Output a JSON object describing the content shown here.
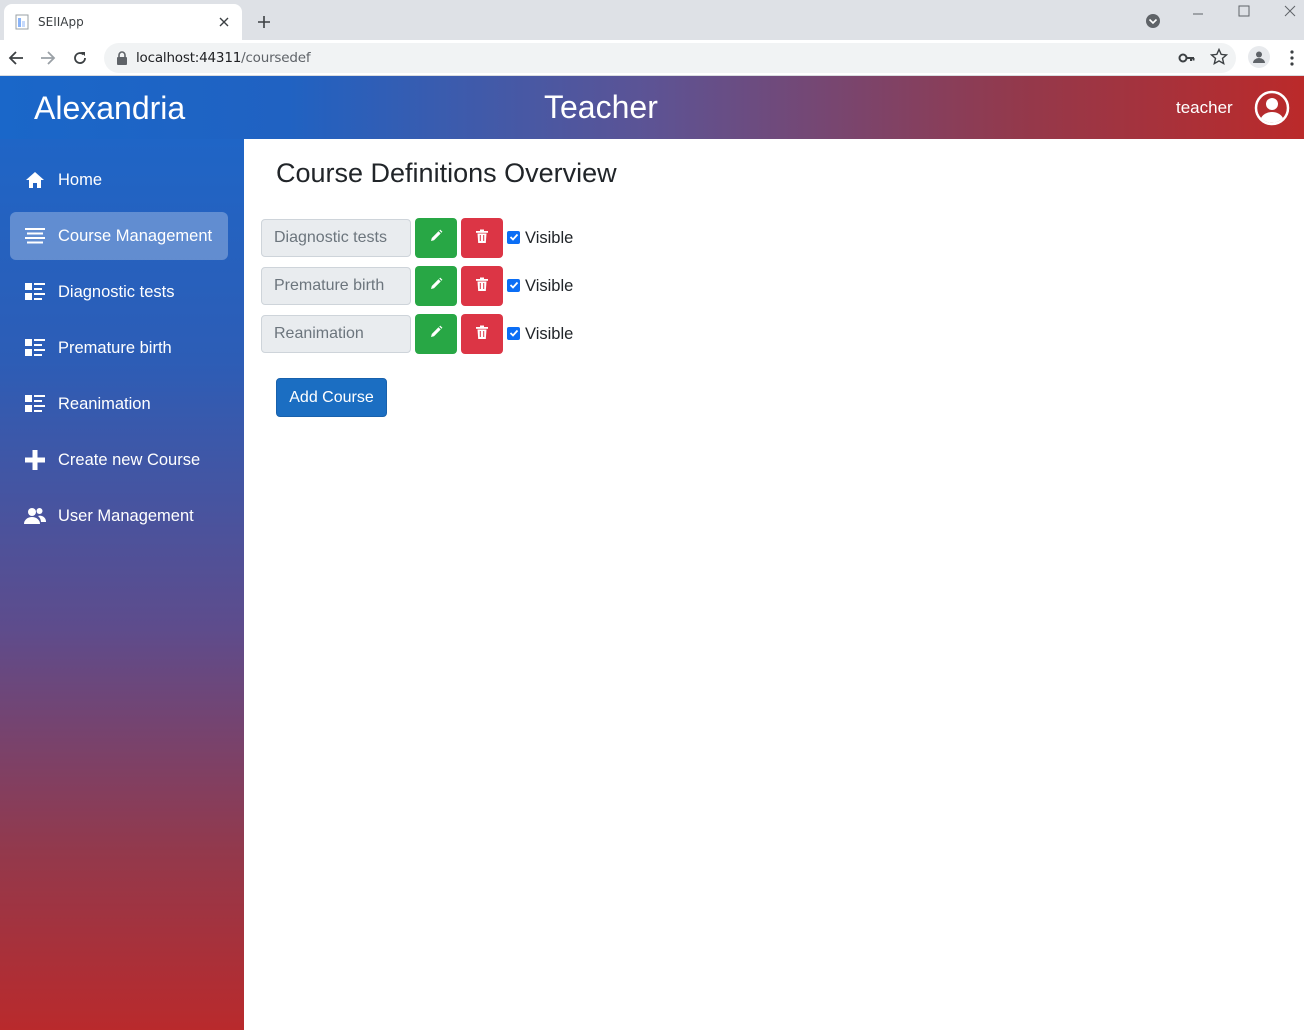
{
  "browser": {
    "tab_title": "SEIIApp",
    "url_host": "localhost:44311",
    "url_path": "/coursedef"
  },
  "header": {
    "brand": "Alexandria",
    "role": "Teacher",
    "username": "teacher"
  },
  "sidebar": {
    "items": [
      {
        "label": "Home",
        "icon": "home-icon"
      },
      {
        "label": "Course Management",
        "icon": "list-icon",
        "active": true
      },
      {
        "label": "Diagnostic tests",
        "icon": "grid-list-icon"
      },
      {
        "label": "Premature birth",
        "icon": "grid-list-icon"
      },
      {
        "label": "Reanimation",
        "icon": "grid-list-icon"
      },
      {
        "label": "Create new Course",
        "icon": "plus-icon"
      },
      {
        "label": "User Management",
        "icon": "users-icon"
      }
    ]
  },
  "main": {
    "title": "Course Definitions Overview",
    "courses": [
      {
        "name": "Diagnostic tests",
        "visible_label": "Visible",
        "visible": true
      },
      {
        "name": "Premature birth",
        "visible_label": "Visible",
        "visible": true
      },
      {
        "name": "Reanimation",
        "visible_label": "Visible",
        "visible": true
      }
    ],
    "add_button": "Add Course"
  },
  "colors": {
    "edit_button": "#28a745",
    "delete_button": "#dc3545",
    "primary_button": "#1b6ec2",
    "checkbox": "#0b6ef5"
  }
}
